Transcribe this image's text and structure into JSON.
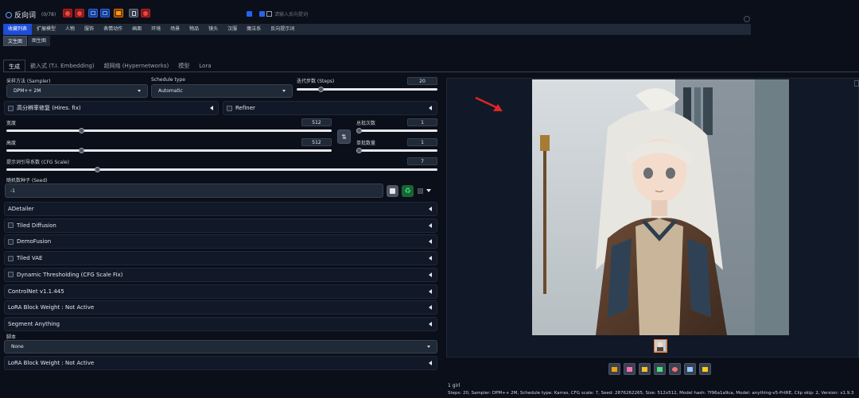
{
  "header": {
    "brand": "反向词",
    "count": "(0/78)",
    "search_placeholder": "请输入反向提词"
  },
  "categories": [
    "收藏列表",
    "扩展模型",
    "人物",
    "服饰",
    "表情动作",
    "画面",
    "环境",
    "场景",
    "物品",
    "镜头",
    "汉服",
    "魔法系",
    "反向提示词"
  ],
  "subtabs": [
    "文生图",
    "图生图"
  ],
  "tabs": [
    "生成",
    "嵌入式 (T.I. Embedding)",
    "超网络 (Hypernetworks)",
    "模型",
    "Lora"
  ],
  "sampler": {
    "label": "采样方法 (Sampler)",
    "value": "DPM++ 2M"
  },
  "schedule": {
    "label": "Schedule type",
    "value": "Automatic"
  },
  "steps": {
    "label": "迭代步数 (Steps)",
    "value": "20",
    "fraction": 0.17
  },
  "hires_label": "高分辨率修复 (Hires. fix)",
  "refiner_label": "Refiner",
  "width": {
    "label": "宽度",
    "value": "512",
    "fraction": 0.23
  },
  "height": {
    "label": "高度",
    "value": "512",
    "fraction": 0.23
  },
  "batch_count": {
    "label": "总批次数",
    "value": "1",
    "fraction": 0.0
  },
  "batch_size": {
    "label": "单批数量",
    "value": "1",
    "fraction": 0.0
  },
  "cfg": {
    "label": "提示词引导系数 (CFG Scale)",
    "value": "7",
    "fraction": 0.21
  },
  "seed": {
    "label": "随机数种子 (Seed)",
    "value": "-1"
  },
  "accordions": [
    {
      "label": "ADetailer",
      "checkbox": false
    },
    {
      "label": "Tiled Diffusion",
      "checkbox": true
    },
    {
      "label": "DemoFusion",
      "checkbox": true
    },
    {
      "label": "Tiled VAE",
      "checkbox": true
    },
    {
      "label": "Dynamic Thresholding (CFG Scale Fix)",
      "checkbox": true
    },
    {
      "label": "ControlNet v1.1.445",
      "checkbox": false
    },
    {
      "label": "LoRA Block Weight : Not Active",
      "checkbox": false
    },
    {
      "label": "Segment Anything",
      "checkbox": false
    }
  ],
  "script": {
    "label": "脚本",
    "value": "None"
  },
  "lora_block_bottom": "LoRA Block Weight : Not Active",
  "output": {
    "caption_title": "1 girl",
    "caption_params": "Steps: 20, Sampler: DPM++ 2M, Schedule type: Karras, CFG scale: 7, Seed: 2876262265, Size: 512x512, Model hash: 7f96a1a9ca, Model: anything-v5-PrtRE, Clip skip: 2, Version: v1.9.3"
  },
  "colors": {
    "accent": "#1d4ed8",
    "bg": "#0b0f19",
    "arrow": "#dc2626"
  }
}
